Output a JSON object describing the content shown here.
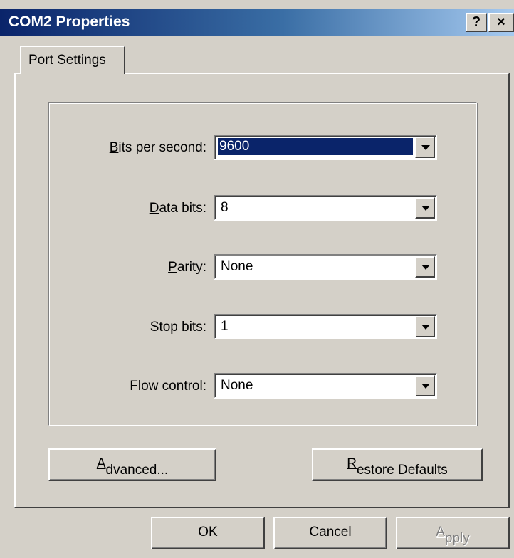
{
  "window": {
    "title": "COM2 Properties",
    "help_glyph": "?",
    "close_glyph": "×"
  },
  "tabs": [
    {
      "label": "Port Settings",
      "selected": true
    }
  ],
  "settings": [
    {
      "label_access": "B",
      "label_rest": "its per second:",
      "value": "9600",
      "selected": true
    },
    {
      "label_access": "D",
      "label_rest": "ata bits:",
      "value": "8",
      "selected": false
    },
    {
      "label_access": "P",
      "label_rest": "arity:",
      "value": "None",
      "selected": false
    },
    {
      "label_access": "S",
      "label_rest": "top bits:",
      "value": "1",
      "selected": false
    },
    {
      "label_access": "F",
      "label_rest": "low control:",
      "value": "None",
      "selected": false
    }
  ],
  "buttons": {
    "advanced": {
      "access": "A",
      "rest": "dvanced..."
    },
    "restore": {
      "access": "R",
      "rest": "estore Defaults"
    },
    "ok": "OK",
    "cancel": "Cancel",
    "apply": {
      "access": "A",
      "rest": "pply",
      "disabled": true
    }
  },
  "colors": {
    "face": "#d4d0c8",
    "title_start": "#0a246a",
    "title_end": "#a6caf0",
    "selection": "#0a246a"
  }
}
